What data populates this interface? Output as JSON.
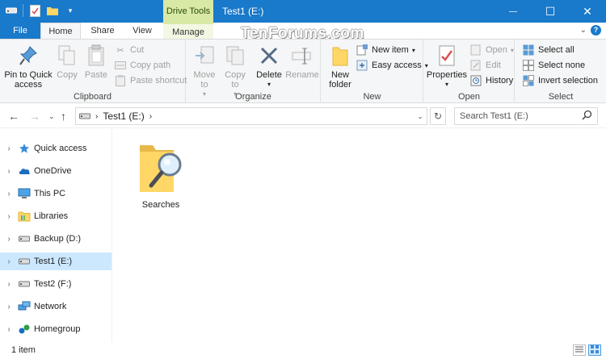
{
  "titlebar": {
    "context_tab": "Drive Tools",
    "title": "Test1 (E:)",
    "minimize_glyph": "—",
    "maximize_glyph": "☐",
    "close_glyph": "✕"
  },
  "watermark": "TenForums.com",
  "tabs": {
    "file": "File",
    "home": "Home",
    "share": "Share",
    "view": "View",
    "manage": "Manage"
  },
  "ribbon": {
    "clipboard": {
      "label": "Clipboard",
      "pin": "Pin to Quick access",
      "copy": "Copy",
      "paste": "Paste",
      "cut": "Cut",
      "copy_path": "Copy path",
      "paste_shortcut": "Paste shortcut"
    },
    "organize": {
      "label": "Organize",
      "move_to": "Move to",
      "copy_to": "Copy to",
      "delete": "Delete",
      "rename": "Rename"
    },
    "new": {
      "label": "New",
      "new_folder": "New folder",
      "new_item": "New item",
      "easy_access": "Easy access"
    },
    "open": {
      "label": "Open",
      "properties": "Properties",
      "open": "Open",
      "edit": "Edit",
      "history": "History"
    },
    "select": {
      "label": "Select",
      "select_all": "Select all",
      "select_none": "Select none",
      "invert": "Invert selection"
    }
  },
  "address": {
    "path": "Test1 (E:)",
    "search_placeholder": "Search Test1 (E:)"
  },
  "navpane": {
    "items": [
      {
        "label": "Quick access",
        "icon": "star-icon"
      },
      {
        "label": "OneDrive",
        "icon": "cloud-icon"
      },
      {
        "label": "This PC",
        "icon": "computer-icon"
      },
      {
        "label": "Libraries",
        "icon": "library-icon"
      },
      {
        "label": "Backup (D:)",
        "icon": "drive-icon"
      },
      {
        "label": "Test1 (E:)",
        "icon": "drive-icon",
        "selected": true
      },
      {
        "label": "Test2 (F:)",
        "icon": "drive-icon"
      },
      {
        "label": "Network",
        "icon": "network-icon"
      },
      {
        "label": "Homegroup",
        "icon": "homegroup-icon"
      }
    ]
  },
  "content": {
    "items": [
      {
        "label": "Searches",
        "icon": "search-folder-icon"
      }
    ]
  },
  "status": {
    "count": "1 item"
  },
  "colors": {
    "accent": "#1979ca",
    "context": "#d8e9a6",
    "selection": "#cce8ff"
  }
}
